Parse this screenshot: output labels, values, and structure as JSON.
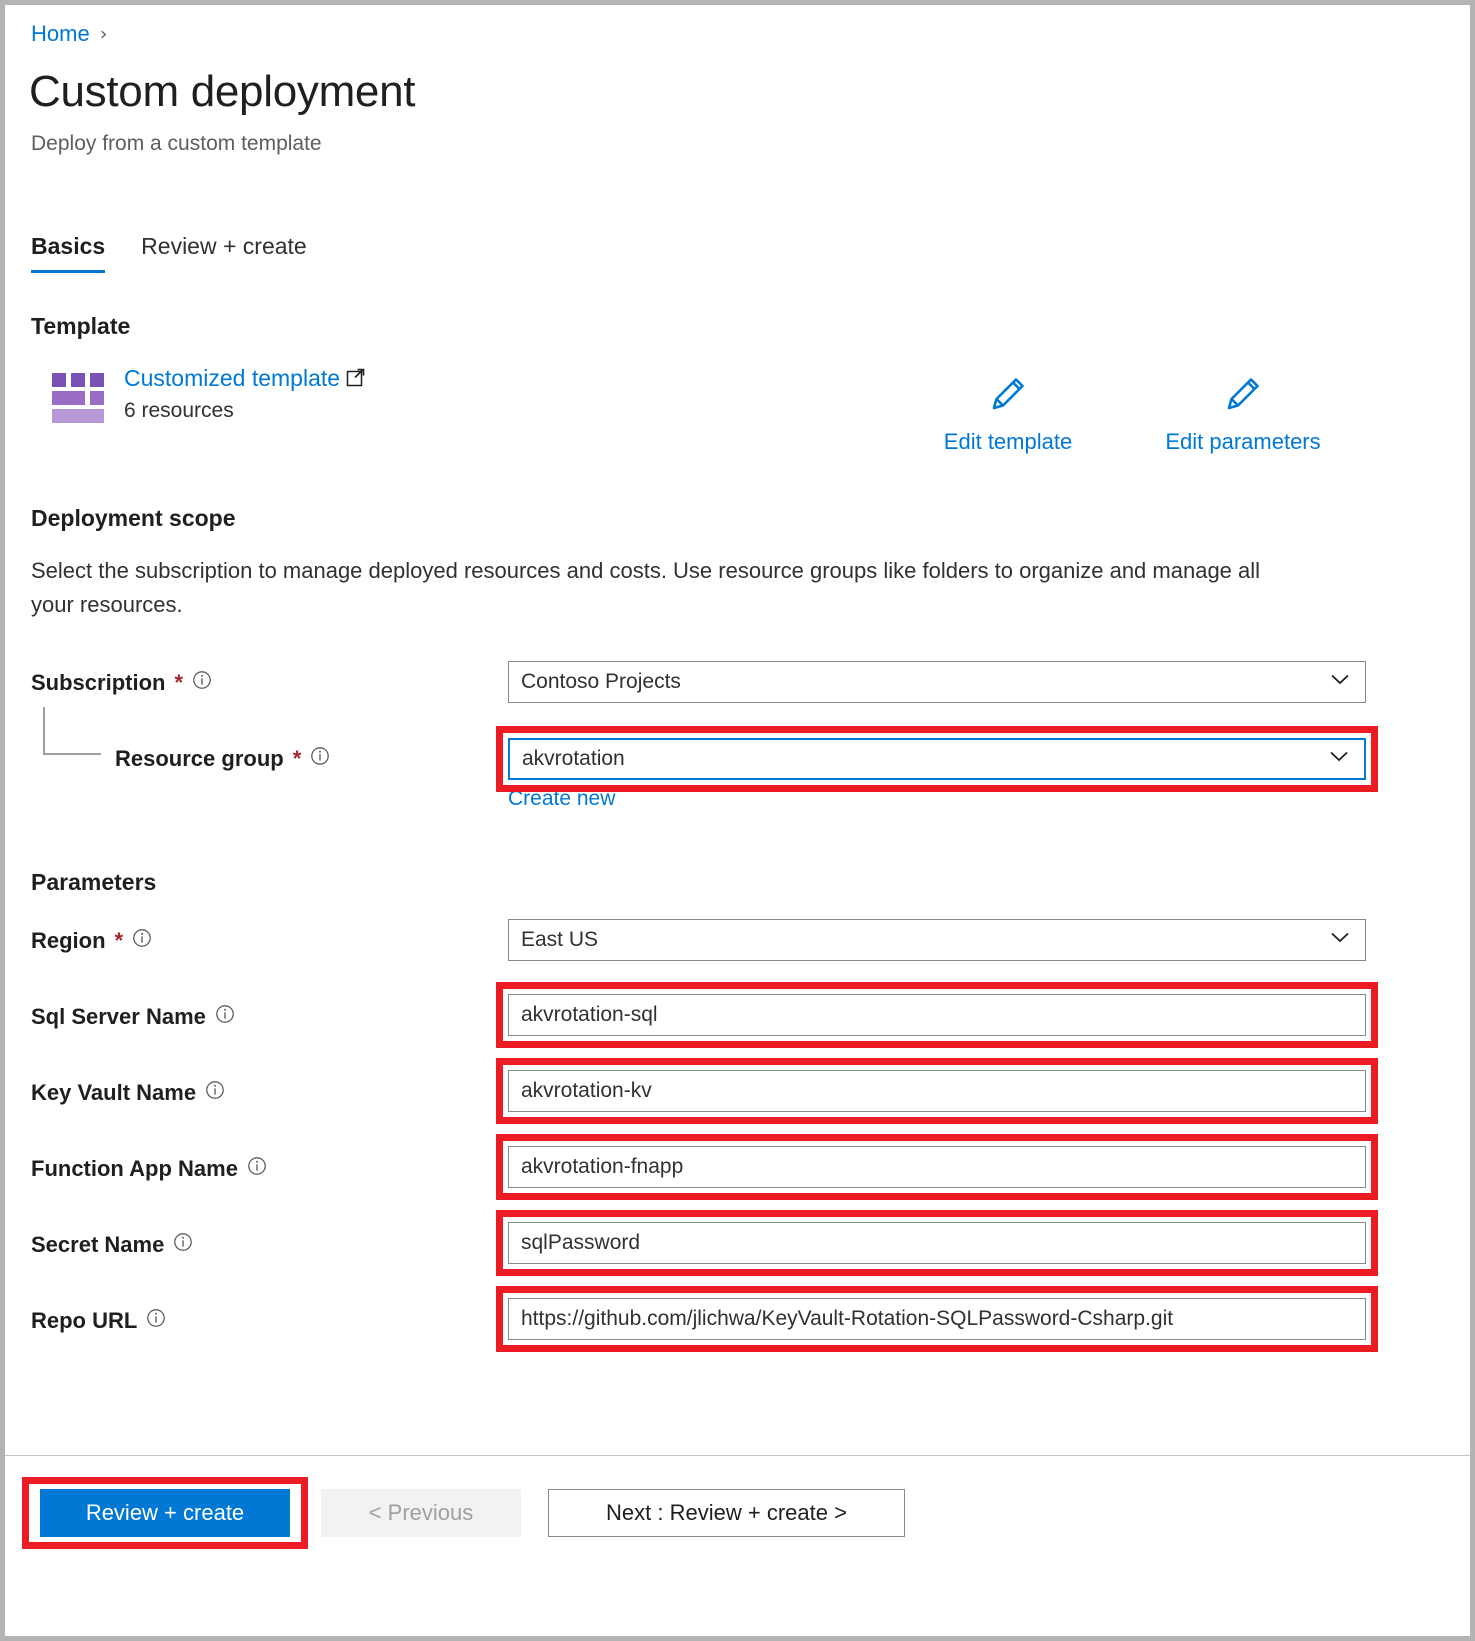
{
  "breadcrumb": {
    "home_label": "Home",
    "separator": "›"
  },
  "header": {
    "title": "Custom deployment",
    "subtitle": "Deploy from a custom template"
  },
  "tabs": [
    {
      "label": "Basics",
      "active": true
    },
    {
      "label": "Review + create",
      "active": false
    }
  ],
  "template": {
    "heading": "Template",
    "link_label": "Customized template",
    "resources_label": "6 resources",
    "edit_template_label": "Edit template",
    "edit_parameters_label": "Edit parameters"
  },
  "deployment_scope": {
    "heading": "Deployment scope",
    "description": "Select the subscription to manage deployed resources and costs. Use resource groups like folders to organize and manage all your resources.",
    "subscription": {
      "label": "Subscription",
      "required": "*",
      "value": "Contoso Projects"
    },
    "resource_group": {
      "label": "Resource group",
      "required": "*",
      "value": "akvrotation",
      "create_new_label": "Create new"
    }
  },
  "parameters": {
    "heading": "Parameters",
    "rows": [
      {
        "label": "Region",
        "required": "*",
        "value": "East US",
        "type": "select",
        "highlighted": false
      },
      {
        "label": "Sql Server Name",
        "required": "",
        "value": "akvrotation-sql",
        "type": "text",
        "highlighted": true
      },
      {
        "label": "Key Vault Name",
        "required": "",
        "value": "akvrotation-kv",
        "type": "text",
        "highlighted": true
      },
      {
        "label": "Function App Name",
        "required": "",
        "value": "akvrotation-fnapp",
        "type": "text",
        "highlighted": true
      },
      {
        "label": "Secret Name",
        "required": "",
        "value": "sqlPassword",
        "type": "text",
        "highlighted": true
      },
      {
        "label": "Repo URL",
        "required": "",
        "value": "https://github.com/jlichwa/KeyVault-Rotation-SQLPassword-Csharp.git",
        "type": "text",
        "highlighted": true
      }
    ]
  },
  "footer": {
    "review_create_label": "Review + create",
    "previous_label": "< Previous",
    "next_label": "Next : Review + create >"
  },
  "colors": {
    "accent": "#0078d4",
    "annotation": "#ed1c24",
    "required": "#a4262c",
    "template_icon": "#8661c5"
  }
}
